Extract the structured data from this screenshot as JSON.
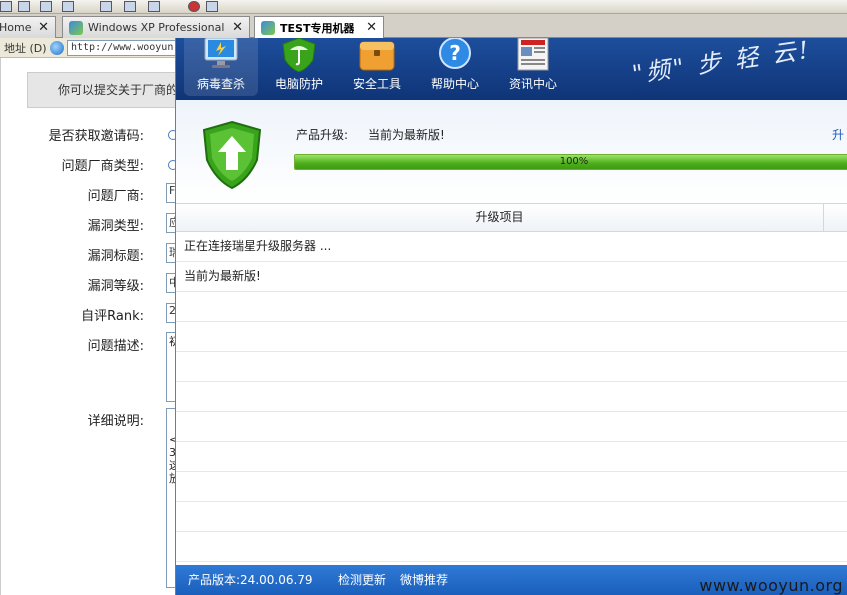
{
  "browser": {
    "tabs": [
      {
        "label": "Home"
      },
      {
        "label": "Windows XP Professional"
      },
      {
        "label": "TEST专用机器"
      }
    ],
    "address": {
      "label": "地址 (D)",
      "url": "http://www.wooyun"
    }
  },
  "webpage": {
    "notice": "你可以提交关于厂商的",
    "fields": [
      {
        "label": "是否获取邀请码:",
        "kind": "radio"
      },
      {
        "label": "问题厂商类型:",
        "kind": "radio"
      },
      {
        "label": "问题厂商:",
        "kind": "input",
        "value": "F"
      },
      {
        "label": "漏洞类型:",
        "kind": "input",
        "value": "应"
      },
      {
        "label": "漏洞标题:",
        "kind": "input",
        "value": "瑞"
      },
      {
        "label": "漏洞等级:",
        "kind": "input",
        "value": "中"
      },
      {
        "label": "自评Rank:",
        "kind": "input",
        "value": "2"
      },
      {
        "label": "问题描述:",
        "kind": "area",
        "value": "初"
      },
      {
        "label": "详细说明:",
        "kind": "area",
        "value": "< 3 这 放"
      }
    ]
  },
  "app": {
    "slogan": "\"频\" 步 轻 云!",
    "nav": [
      {
        "label": "病毒查杀",
        "icon": "monitor-icon",
        "active": true
      },
      {
        "label": "电脑防护",
        "icon": "umbrella-shield-icon",
        "active": false
      },
      {
        "label": "安全工具",
        "icon": "toolbox-icon",
        "active": false
      },
      {
        "label": "帮助中心",
        "icon": "help-icon",
        "active": false
      },
      {
        "label": "资讯中心",
        "icon": "news-icon",
        "active": false
      }
    ],
    "upgrade": {
      "label": "产品升级:",
      "status": "当前为最新版!",
      "link": "升",
      "progress_percent": 100,
      "progress_text": "100%"
    },
    "table": {
      "column_title": "升级项目",
      "rows": [
        "正在连接瑞星升级服务器 ...",
        "当前为最新版!",
        "",
        "",
        "",
        "",
        "",
        "",
        "",
        "",
        ""
      ]
    },
    "statusbar": {
      "version": "产品版本:24.00.06.79",
      "check_update": "检测更新",
      "weibo": "微博推荐"
    }
  },
  "watermark": "www.wooyun.org",
  "colors": {
    "header_blue": "#0f3477",
    "status_blue": "#1a5fbc",
    "progress_green": "#4cae1a",
    "shield_green": "#3aa31c"
  }
}
